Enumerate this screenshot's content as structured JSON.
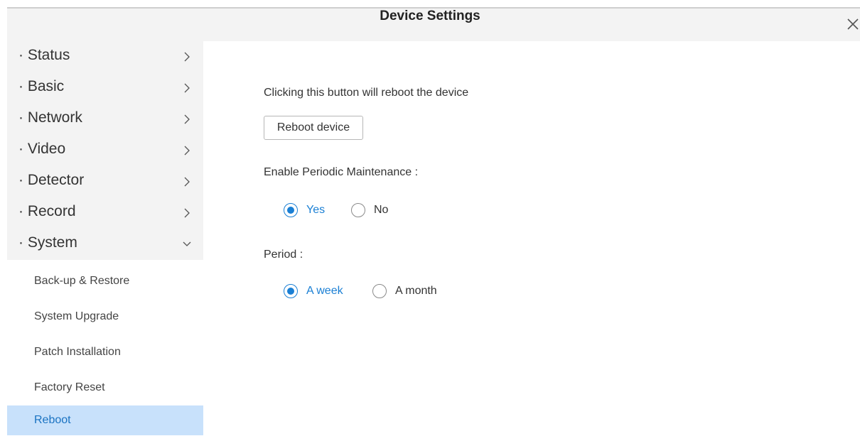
{
  "window": {
    "title": "Device Settings"
  },
  "colors": {
    "accent": "#1a7fd4",
    "selected_bg": "#c8e1fb",
    "sidebar_bg": "#f3f3f3"
  },
  "sidebar": {
    "menu": [
      {
        "label": "· Status",
        "icon": "chevron-right-icon"
      },
      {
        "label": "· Basic",
        "icon": "chevron-right-icon"
      },
      {
        "label": "· Network",
        "icon": "chevron-right-icon"
      },
      {
        "label": "· Video",
        "icon": "chevron-right-icon"
      },
      {
        "label": "· Detector",
        "icon": "chevron-right-icon"
      },
      {
        "label": "· Record",
        "icon": "chevron-right-icon"
      },
      {
        "label": "· System",
        "icon": "chevron-down-icon",
        "expanded": true
      }
    ],
    "submenu": [
      {
        "label": "Back-up & Restore"
      },
      {
        "label": "System Upgrade"
      },
      {
        "label": "Patch Installation"
      },
      {
        "label": "Factory Reset"
      },
      {
        "label": "Reboot",
        "selected": true
      }
    ]
  },
  "main": {
    "reboot_hint": "Clicking this button will reboot the device",
    "reboot_button": "Reboot device",
    "maintenance_label": "Enable Periodic Maintenance :",
    "maintenance_options": [
      {
        "label": "Yes",
        "checked": true
      },
      {
        "label": "No",
        "checked": false
      }
    ],
    "period_label": "Period :",
    "period_options": [
      {
        "label": "A week",
        "checked": true
      },
      {
        "label": "A month",
        "checked": false
      }
    ]
  }
}
